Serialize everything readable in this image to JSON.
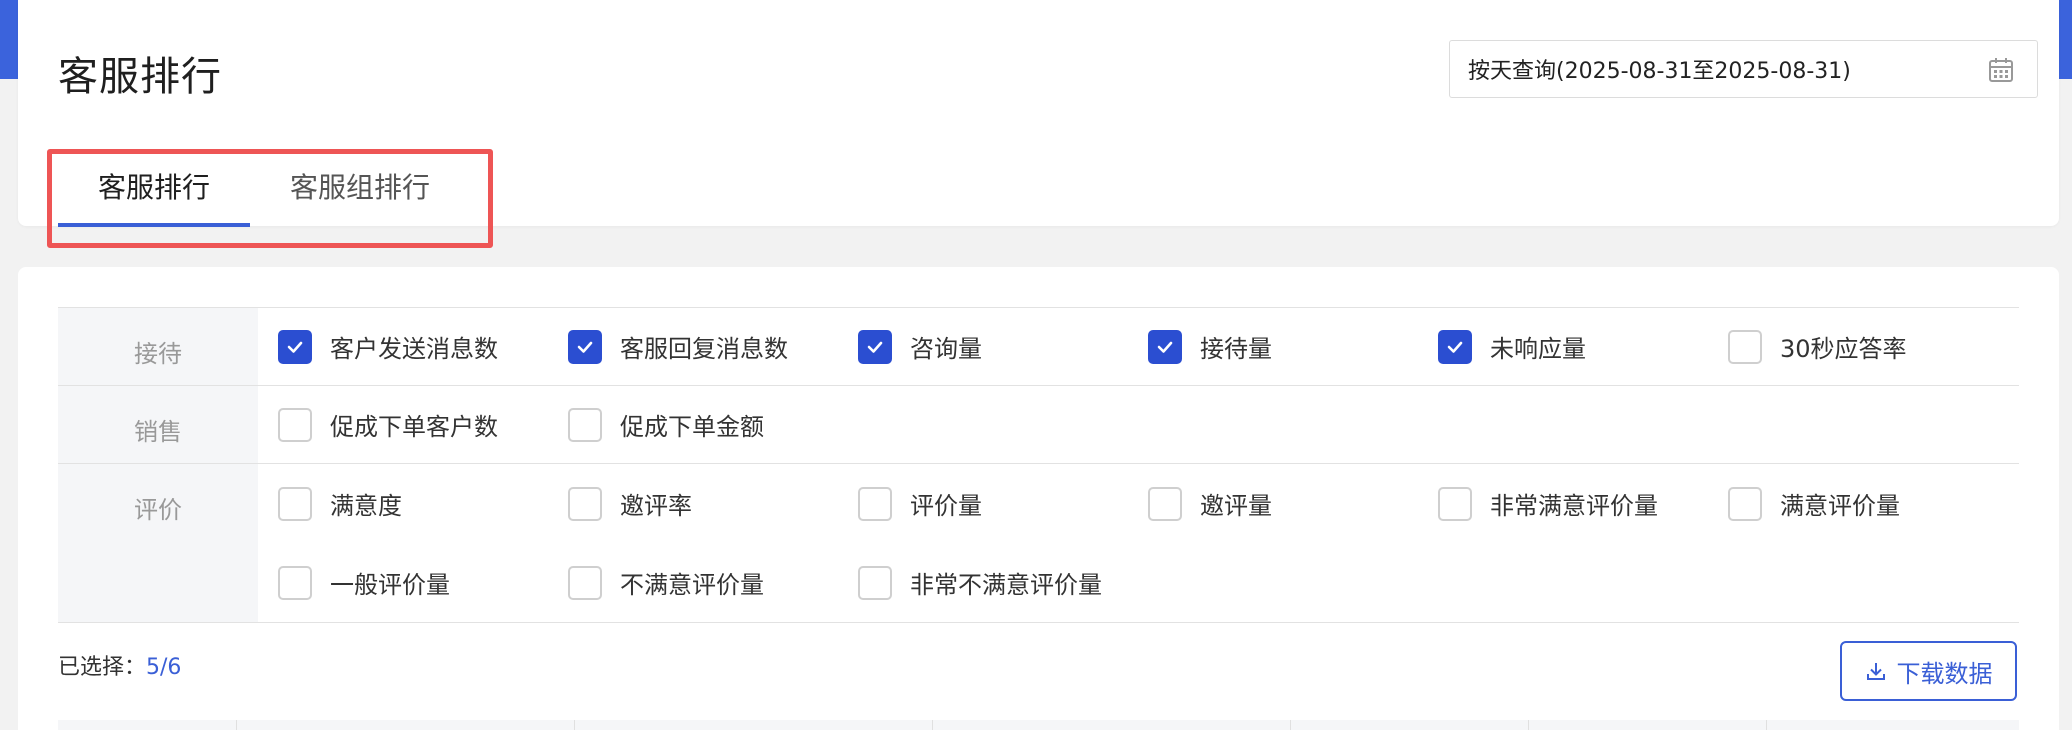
{
  "header": {
    "title": "客服排行",
    "date_range": "按天查询(2025-08-31至2025-08-31)"
  },
  "tabs": [
    {
      "label": "客服排行",
      "active": true
    },
    {
      "label": "客服组排行",
      "active": false
    }
  ],
  "metrics": {
    "reception": {
      "label": "接待",
      "items": [
        {
          "label": "客户发送消息数",
          "checked": true
        },
        {
          "label": "客服回复消息数",
          "checked": true
        },
        {
          "label": "咨询量",
          "checked": true
        },
        {
          "label": "接待量",
          "checked": true
        },
        {
          "label": "未响应量",
          "checked": true
        },
        {
          "label": "30秒应答率",
          "checked": false
        }
      ]
    },
    "sales": {
      "label": "销售",
      "items": [
        {
          "label": "促成下单客户数",
          "checked": false
        },
        {
          "label": "促成下单金额",
          "checked": false
        }
      ]
    },
    "evaluation": {
      "label": "评价",
      "items": [
        {
          "label": "满意度",
          "checked": false
        },
        {
          "label": "邀评率",
          "checked": false
        },
        {
          "label": "评价量",
          "checked": false
        },
        {
          "label": "邀评量",
          "checked": false
        },
        {
          "label": "非常满意评价量",
          "checked": false
        },
        {
          "label": "满意评价量",
          "checked": false
        },
        {
          "label": "一般评价量",
          "checked": false
        },
        {
          "label": "不满意评价量",
          "checked": false
        },
        {
          "label": "非常不满意评价量",
          "checked": false
        }
      ]
    }
  },
  "footer": {
    "selected_label": "已选择：",
    "selected_count": "5/6",
    "download_label": "下载数据"
  },
  "colors": {
    "accent": "#3a5fd6",
    "checkbox_checked": "#2b4ed1",
    "highlight": "#ee5555",
    "brand_strip": "#3b63dc"
  }
}
